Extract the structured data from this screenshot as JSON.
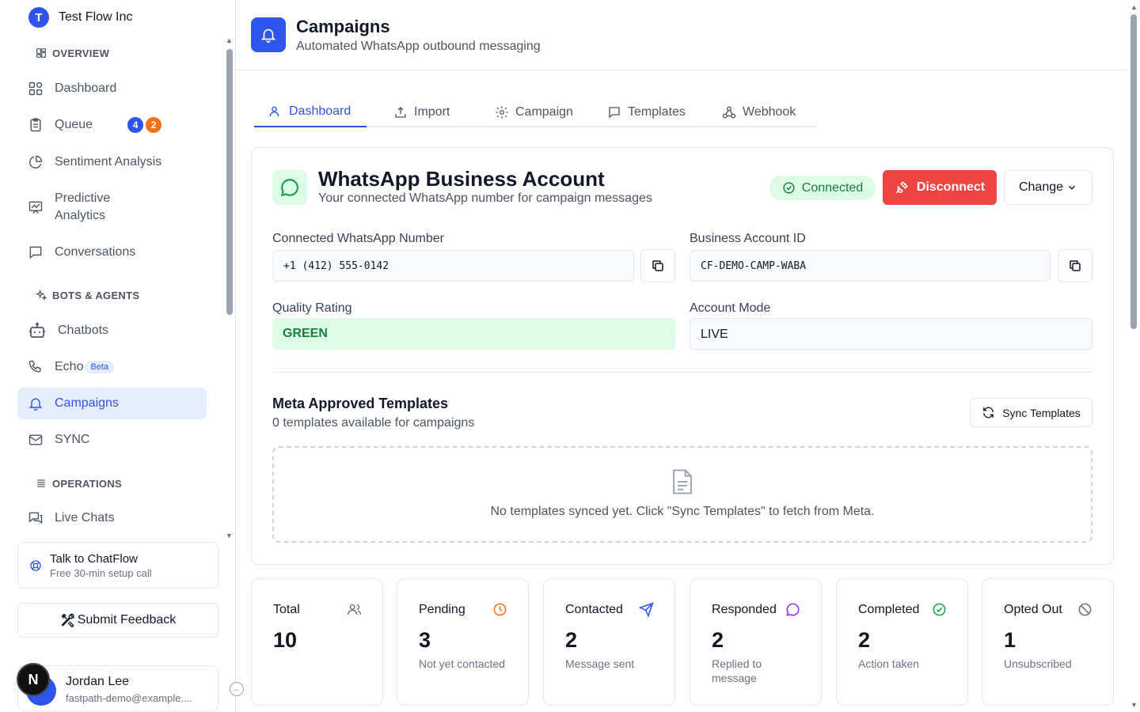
{
  "org": {
    "initial": "T",
    "name": "Test Flow Inc"
  },
  "sidebar": {
    "sections": {
      "overview": "OVERVIEW",
      "bots": "BOTS & AGENTS",
      "operations": "OPERATIONS"
    },
    "items": {
      "dashboard": "Dashboard",
      "queue": "Queue",
      "sentiment": "Sentiment Analysis",
      "predictive_line1": "Predictive",
      "predictive_line2": "Analytics",
      "conversations": "Conversations",
      "chatbots": "Chatbots",
      "echo": "Echo",
      "echo_badge": "Beta",
      "campaigns": "Campaigns",
      "sync": "SYNC",
      "live_chats": "Live Chats"
    },
    "queue_badges": [
      "4",
      "2"
    ],
    "talk": {
      "title": "Talk to ChatFlow",
      "subtitle": "Free 30-min setup call"
    },
    "feedback_label": "Submit Feedback",
    "user": {
      "name": "Jordan Lee",
      "email": "fastpath-demo@example...."
    },
    "next_badge": "N"
  },
  "header": {
    "title": "Campaigns",
    "subtitle": "Automated WhatsApp outbound messaging"
  },
  "tabs": [
    "Dashboard",
    "Import",
    "Campaign",
    "Templates",
    "Webhook"
  ],
  "whatsapp": {
    "title": "WhatsApp Business Account",
    "subtitle": "Your connected WhatsApp number for campaign messages",
    "status": "Connected",
    "disconnect_label": "Disconnect",
    "change_label": "Change",
    "number_label": "Connected WhatsApp Number",
    "number_value": "+1 (412) 555-0142",
    "account_id_label": "Business Account ID",
    "account_id_value": "CF-DEMO-CAMP-WABA",
    "quality_label": "Quality Rating",
    "quality_value": "GREEN",
    "mode_label": "Account Mode",
    "mode_value": "LIVE"
  },
  "templates": {
    "title": "Meta Approved Templates",
    "subtitle": "0 templates available for campaigns",
    "sync_label": "Sync Templates",
    "empty_text": "No templates synced yet. Click \"Sync Templates\" to fetch from Meta."
  },
  "stats": [
    {
      "label": "Total",
      "value": "10",
      "sub": ""
    },
    {
      "label": "Pending",
      "value": "3",
      "sub": "Not yet contacted"
    },
    {
      "label": "Contacted",
      "value": "2",
      "sub": "Message sent"
    },
    {
      "label": "Responded",
      "value": "2",
      "sub": "Replied to message"
    },
    {
      "label": "Completed",
      "value": "2",
      "sub": "Action taken"
    },
    {
      "label": "Opted Out",
      "value": "1",
      "sub": "Unsubscribed"
    }
  ],
  "colors": {
    "accent": "#2f54eb",
    "success": "#15803d",
    "danger": "#ef4444",
    "pending": "#f97316",
    "responded": "#9333ea"
  }
}
